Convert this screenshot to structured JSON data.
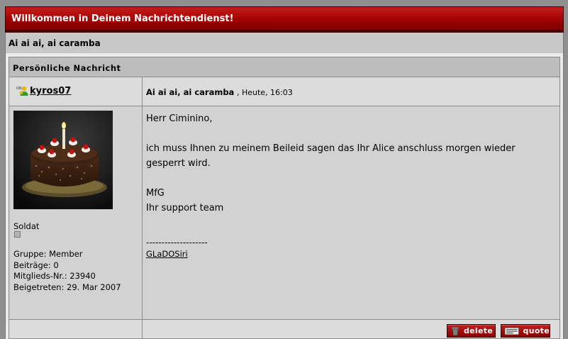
{
  "banner": {
    "title": "Willkommen in Deinem Nachrichtendienst!"
  },
  "page": {
    "subtitle": "Ai ai ai, ai caramba"
  },
  "message": {
    "box_title": "Persönliche Nachricht",
    "author": {
      "username": "kyros07",
      "online_icon": "online-user-icon",
      "avatar": "birthday-cake-avatar",
      "rank": "Soldat",
      "group": "Gruppe: Member",
      "posts": "Beiträge: 0",
      "member_no": "Mitglieds-Nr.: 23940",
      "joined": "Beigetreten: 29. Mar 2007"
    },
    "subject": "Ai ai ai, ai caramba",
    "date": ", Heute, 16:03",
    "body": {
      "greeting": "Herr Ciminino,",
      "line1": "ich muss Ihnen zu meinem Beileid sagen das Ihr Alice anschluss morgen wieder",
      "line2": "gesperrt wird.",
      "closing": "MfG",
      "team": "Ihr support team"
    },
    "signature": {
      "separator": "--------------------",
      "name": "GLaDOSiri"
    }
  },
  "actions": {
    "delete_label": "delete",
    "quote_label": "quote"
  },
  "colors": {
    "accent_red": "#a30000",
    "panel_gray": "#d2d2d2"
  }
}
